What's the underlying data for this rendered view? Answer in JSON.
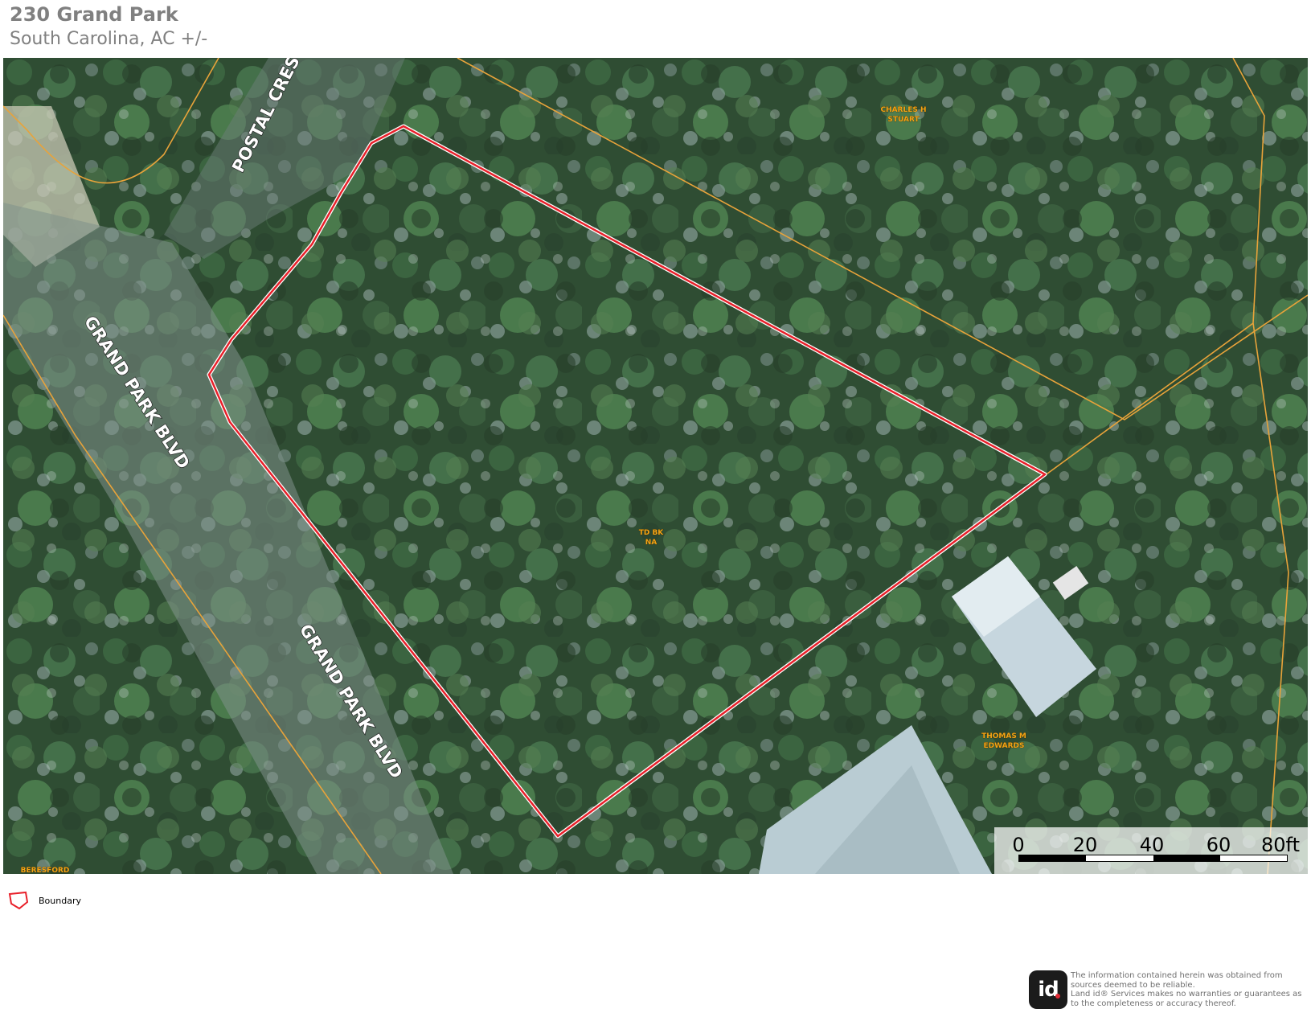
{
  "header": {
    "title": "230 Grand Park",
    "subtitle": "South Carolina,  AC +/-"
  },
  "map": {
    "street_labels": [
      "POSTAL CRESC",
      "GRAND PARK BLVD",
      "GRAND PARK BLVD"
    ],
    "owner_labels": [
      {
        "line1": "CHARLES H",
        "line2": "STUART"
      },
      {
        "line1": "TD BK",
        "line2": "NA"
      },
      {
        "line1": "THOMAS M",
        "line2": "EDWARDS"
      },
      {
        "line1": "BERESFORD",
        "line2": ""
      }
    ],
    "boundary_color": "#e8202a",
    "parcel_line_color": "#e8a33a"
  },
  "scale": {
    "ticks": [
      "0",
      "20",
      "40",
      "60",
      "80ft"
    ]
  },
  "legend": {
    "items": [
      {
        "icon": "boundary-polygon-icon",
        "label": "Boundary",
        "color": "#e8202a"
      }
    ]
  },
  "footer": {
    "logo_text": "id",
    "disclaimer": "The information contained herein was obtained from sources deemed to be reliable.\n Land id® Services makes no warranties or guarantees as to the completeness or accuracy thereof."
  }
}
